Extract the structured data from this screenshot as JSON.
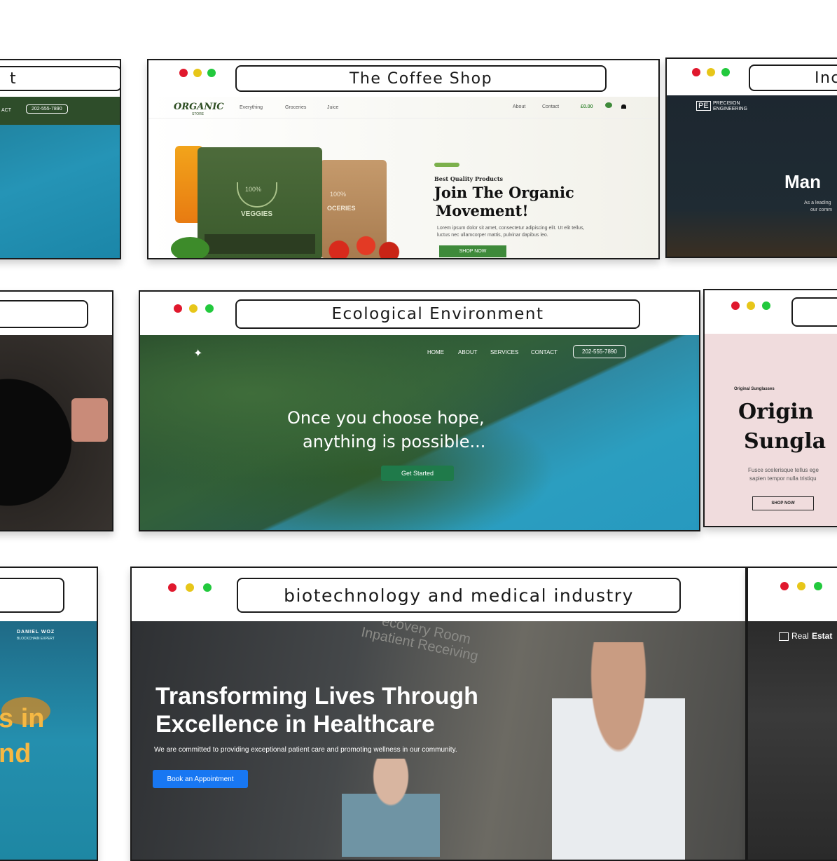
{
  "windows": {
    "left_top": {
      "title": "t",
      "phone": "202-555-7890",
      "nav_fragment": "ACT"
    },
    "coffee": {
      "title": "The Coffee Shop",
      "logo": "ORGANIC",
      "logo_sub": "STORE",
      "nav": [
        "Everything",
        "Groceries",
        "Juice"
      ],
      "nav_right": [
        "About",
        "Contact"
      ],
      "cart": "£0.00",
      "bag_label_1": "VEGGIES",
      "bag_label_2": "OCERIES",
      "badge": "100%",
      "eyebrow": "Best Quality Products",
      "headline_1": "Join The Organic",
      "headline_2": "Movement!",
      "body_1": "Lorem ipsum dolor sit amet, consectetur adipiscing elit. Ut elit tellus,",
      "body_2": "luctus nec ullamcorper mattis, pulvinar dapibus leo.",
      "cta": "SHOP NOW"
    },
    "right_top": {
      "title": "Inc",
      "logo_mark": "PE",
      "logo_line_1": "PRECISION",
      "logo_line_2": "ENGINEERING",
      "headline": "Man",
      "body_1": "As a leading",
      "body_2": "our comm"
    },
    "ecological": {
      "title": "Ecological Environment",
      "nav": [
        "HOME",
        "ABOUT",
        "SERVICES",
        "CONTACT"
      ],
      "phone": "202-555-7890",
      "headline_1": "Once you choose hope,",
      "headline_2": "anything is possible...",
      "cta": "Get Started"
    },
    "right_mid": {
      "eyebrow": "Original Sunglasses",
      "headline_1": "Origin",
      "headline_2": "Sungla",
      "body_1": "Fusce scelerisque tellus ege",
      "body_2": "sapien tempor nulla tristiqu",
      "cta": "SHOP NOW"
    },
    "left_bottom": {
      "name": "DANIEL WOZ",
      "role": "BLOCKCHAIN EXPERT",
      "headline_1": "s in",
      "headline_2": "nd"
    },
    "medical": {
      "title": "biotechnology and medical industry",
      "sign_1": "ecovery Room",
      "sign_2": "Inpatient Receiving",
      "headline_1": "Transforming Lives Through",
      "headline_2": "Excellence in Healthcare",
      "body": "We are committed to providing exceptional patient care and promoting wellness in our community.",
      "cta": "Book an Appointment"
    },
    "right_bottom": {
      "logo_a": "Real",
      "logo_b": "Estat"
    }
  },
  "colors": {
    "dot_red": "#e0182d",
    "dot_yellow": "#e7c619",
    "dot_green": "#22c93d",
    "organic_green": "#3e8a3a",
    "eco_button": "#1f7a4a",
    "medical_button": "#1877f2"
  }
}
